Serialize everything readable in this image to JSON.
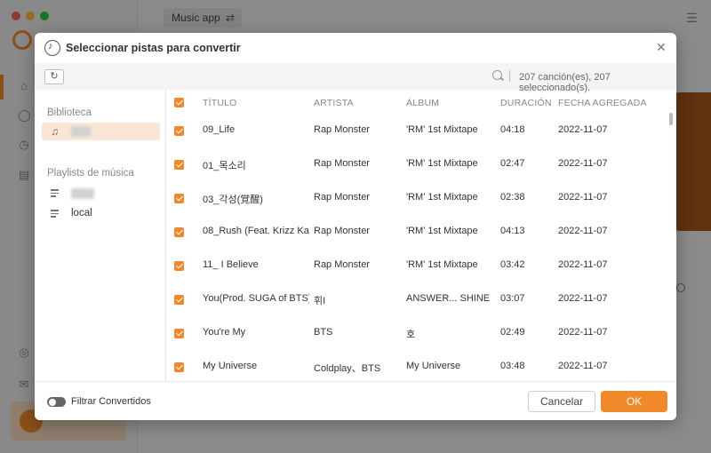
{
  "app": {
    "top_pill_label": "Music app",
    "top_pill_icon": "swap-icon",
    "accent_color": "#f0892a"
  },
  "modal": {
    "title": "Seleccionar pistas para convertir",
    "count_text": "207 canción(es), 207 seleccionado(s)."
  },
  "sidebar": {
    "library_title": "Biblioteca",
    "playlists_title": "Playlists de música",
    "playlists": [
      {
        "label": ""
      },
      {
        "label": "local"
      }
    ]
  },
  "table": {
    "columns": [
      "TÍTULO",
      "ARTISTA",
      "ÁLBUM",
      "DURACIÓN",
      "FECHA AGREGADA"
    ],
    "rows": [
      {
        "title": "09_Life",
        "artist": "Rap Monster",
        "album": "'RM' 1st Mixtape",
        "duration": "04:18",
        "date": "2022-11-07"
      },
      {
        "title": "01_목소리",
        "artist": "Rap Monster",
        "album": "'RM' 1st Mixtape",
        "duration": "02:47",
        "date": "2022-11-07"
      },
      {
        "title": "03_각성(覚醒)",
        "artist": "Rap Monster",
        "album": "'RM' 1st Mixtape",
        "duration": "02:38",
        "date": "2022-11-07"
      },
      {
        "title": "08_Rush (Feat. Krizz Kal...",
        "artist": "Rap Monster",
        "album": "'RM' 1st Mixtape",
        "duration": "04:13",
        "date": "2022-11-07"
      },
      {
        "title": "11_ I Believe",
        "artist": "Rap Monster",
        "album": "'RM' 1st Mixtape",
        "duration": "03:42",
        "date": "2022-11-07"
      },
      {
        "title": "You(Prod. SUGA of BTS)",
        "artist": "휘I",
        "album": "ANSWER... SHINE",
        "duration": "03:07",
        "date": "2022-11-07"
      },
      {
        "title": "You're My",
        "artist": "BTS",
        "album": "호",
        "duration": "02:49",
        "date": "2022-11-07"
      },
      {
        "title": "My Universe",
        "artist": "Coldplay、BTS",
        "album": "My Universe",
        "duration": "03:48",
        "date": "2022-11-07"
      }
    ]
  },
  "footer": {
    "filter_label": "Filtrar Convertidos",
    "cancel_label": "Cancelar",
    "ok_label": "OK"
  }
}
